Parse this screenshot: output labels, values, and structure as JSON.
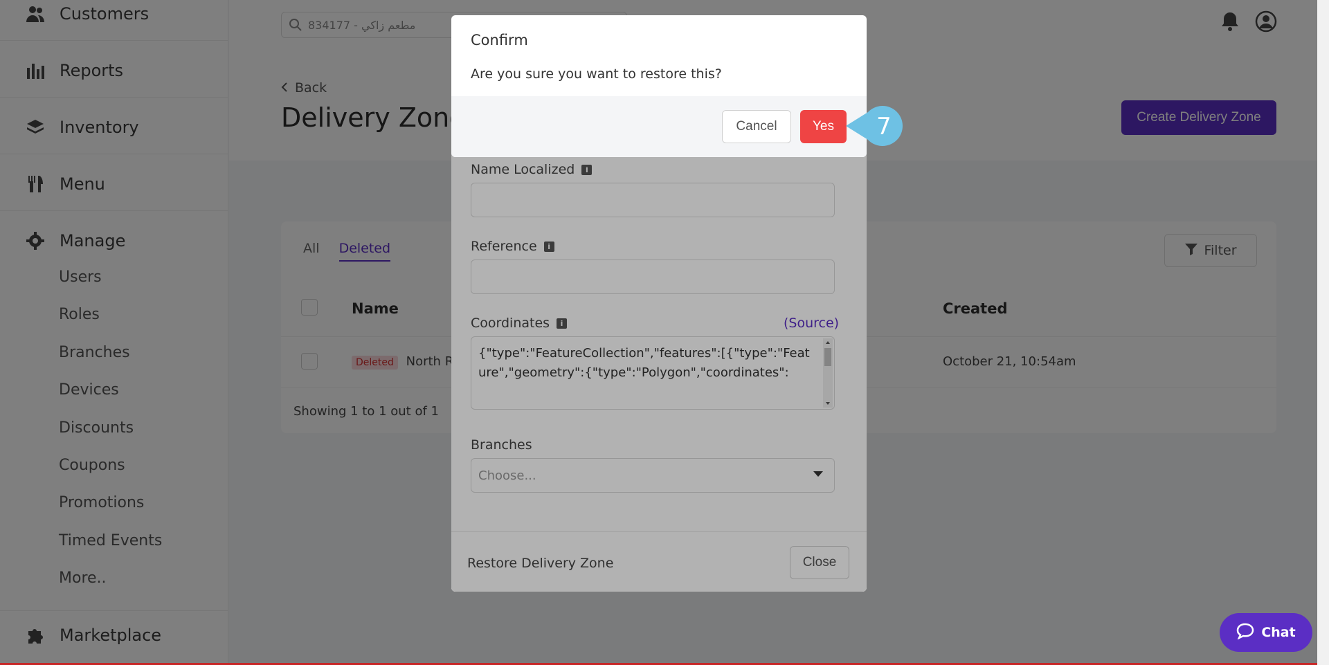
{
  "sidebar": {
    "items": [
      {
        "label": "Customers",
        "icon": "users-icon"
      },
      {
        "label": "Reports",
        "icon": "bar-chart-icon"
      },
      {
        "label": "Inventory",
        "icon": "layers-icon"
      },
      {
        "label": "Menu",
        "icon": "cutlery-icon"
      },
      {
        "label": "Manage",
        "icon": "gear-icon"
      }
    ],
    "manage_sub": [
      "Users",
      "Roles",
      "Branches",
      "Devices",
      "Discounts",
      "Coupons",
      "Promotions",
      "Timed Events",
      "More.."
    ],
    "marketplace": {
      "label": "Marketplace",
      "icon": "puzzle-icon"
    }
  },
  "topbar": {
    "search_value": "مطعم زاكي - 834177"
  },
  "page": {
    "back_label": "Back",
    "title": "Delivery Zones",
    "create_label": "Create Delivery Zone"
  },
  "card": {
    "tabs": [
      {
        "label": "All"
      },
      {
        "label": "Deleted"
      }
    ],
    "filter_label": "Filter",
    "columns": [
      "Name",
      "Created"
    ],
    "row": {
      "badge": "Deleted",
      "name": "North Re",
      "created": "October 21, 10:54am"
    },
    "showing": "Showing 1 to 1 out of 1"
  },
  "form_modal": {
    "name_localized_label": "Name Localized",
    "reference_label": "Reference",
    "coordinates_label": "Coordinates",
    "source_label": "(Source)",
    "coordinates_value": "{\"type\":\"FeatureCollection\",\"features\":[{\"type\":\"Feature\",\"geometry\":{\"type\":\"Polygon\",\"coordinates\":",
    "branches_label": "Branches",
    "branches_placeholder": "Choose...",
    "restore_label": "Restore Delivery Zone",
    "close_label": "Close"
  },
  "confirm": {
    "title": "Confirm",
    "message": "Are you sure you want to restore this?",
    "cancel_label": "Cancel",
    "yes_label": "Yes"
  },
  "callout": {
    "step": "7",
    "color": "#6ec1e4"
  },
  "chat": {
    "label": "Chat"
  },
  "colors": {
    "accent": "#5b2ec4",
    "danger": "#ef4444"
  }
}
